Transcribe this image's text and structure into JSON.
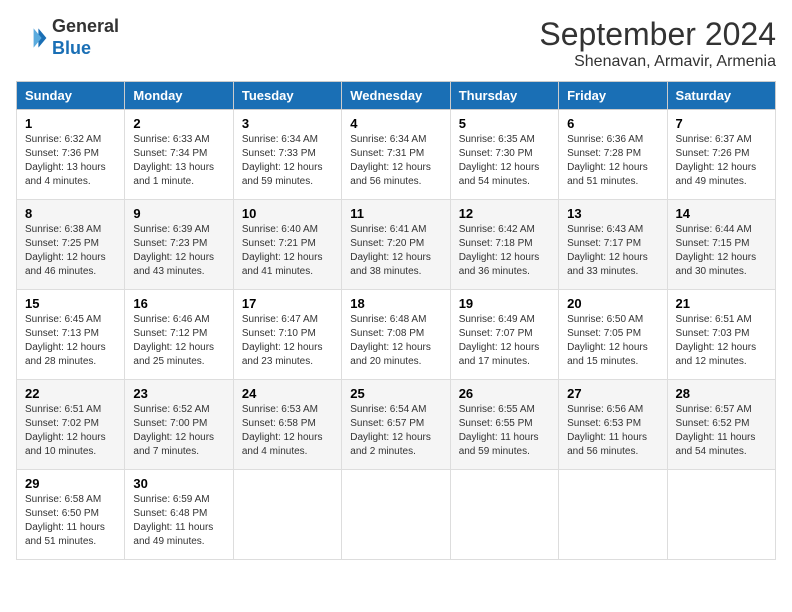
{
  "logo": {
    "line1": "General",
    "line2": "Blue"
  },
  "title": "September 2024",
  "subtitle": "Shenavan, Armavir, Armenia",
  "days_of_week": [
    "Sunday",
    "Monday",
    "Tuesday",
    "Wednesday",
    "Thursday",
    "Friday",
    "Saturday"
  ],
  "weeks": [
    [
      {
        "day": "1",
        "info": "Sunrise: 6:32 AM\nSunset: 7:36 PM\nDaylight: 13 hours and 4 minutes."
      },
      {
        "day": "2",
        "info": "Sunrise: 6:33 AM\nSunset: 7:34 PM\nDaylight: 13 hours and 1 minute."
      },
      {
        "day": "3",
        "info": "Sunrise: 6:34 AM\nSunset: 7:33 PM\nDaylight: 12 hours and 59 minutes."
      },
      {
        "day": "4",
        "info": "Sunrise: 6:34 AM\nSunset: 7:31 PM\nDaylight: 12 hours and 56 minutes."
      },
      {
        "day": "5",
        "info": "Sunrise: 6:35 AM\nSunset: 7:30 PM\nDaylight: 12 hours and 54 minutes."
      },
      {
        "day": "6",
        "info": "Sunrise: 6:36 AM\nSunset: 7:28 PM\nDaylight: 12 hours and 51 minutes."
      },
      {
        "day": "7",
        "info": "Sunrise: 6:37 AM\nSunset: 7:26 PM\nDaylight: 12 hours and 49 minutes."
      }
    ],
    [
      {
        "day": "8",
        "info": "Sunrise: 6:38 AM\nSunset: 7:25 PM\nDaylight: 12 hours and 46 minutes."
      },
      {
        "day": "9",
        "info": "Sunrise: 6:39 AM\nSunset: 7:23 PM\nDaylight: 12 hours and 43 minutes."
      },
      {
        "day": "10",
        "info": "Sunrise: 6:40 AM\nSunset: 7:21 PM\nDaylight: 12 hours and 41 minutes."
      },
      {
        "day": "11",
        "info": "Sunrise: 6:41 AM\nSunset: 7:20 PM\nDaylight: 12 hours and 38 minutes."
      },
      {
        "day": "12",
        "info": "Sunrise: 6:42 AM\nSunset: 7:18 PM\nDaylight: 12 hours and 36 minutes."
      },
      {
        "day": "13",
        "info": "Sunrise: 6:43 AM\nSunset: 7:17 PM\nDaylight: 12 hours and 33 minutes."
      },
      {
        "day": "14",
        "info": "Sunrise: 6:44 AM\nSunset: 7:15 PM\nDaylight: 12 hours and 30 minutes."
      }
    ],
    [
      {
        "day": "15",
        "info": "Sunrise: 6:45 AM\nSunset: 7:13 PM\nDaylight: 12 hours and 28 minutes."
      },
      {
        "day": "16",
        "info": "Sunrise: 6:46 AM\nSunset: 7:12 PM\nDaylight: 12 hours and 25 minutes."
      },
      {
        "day": "17",
        "info": "Sunrise: 6:47 AM\nSunset: 7:10 PM\nDaylight: 12 hours and 23 minutes."
      },
      {
        "day": "18",
        "info": "Sunrise: 6:48 AM\nSunset: 7:08 PM\nDaylight: 12 hours and 20 minutes."
      },
      {
        "day": "19",
        "info": "Sunrise: 6:49 AM\nSunset: 7:07 PM\nDaylight: 12 hours and 17 minutes."
      },
      {
        "day": "20",
        "info": "Sunrise: 6:50 AM\nSunset: 7:05 PM\nDaylight: 12 hours and 15 minutes."
      },
      {
        "day": "21",
        "info": "Sunrise: 6:51 AM\nSunset: 7:03 PM\nDaylight: 12 hours and 12 minutes."
      }
    ],
    [
      {
        "day": "22",
        "info": "Sunrise: 6:51 AM\nSunset: 7:02 PM\nDaylight: 12 hours and 10 minutes."
      },
      {
        "day": "23",
        "info": "Sunrise: 6:52 AM\nSunset: 7:00 PM\nDaylight: 12 hours and 7 minutes."
      },
      {
        "day": "24",
        "info": "Sunrise: 6:53 AM\nSunset: 6:58 PM\nDaylight: 12 hours and 4 minutes."
      },
      {
        "day": "25",
        "info": "Sunrise: 6:54 AM\nSunset: 6:57 PM\nDaylight: 12 hours and 2 minutes."
      },
      {
        "day": "26",
        "info": "Sunrise: 6:55 AM\nSunset: 6:55 PM\nDaylight: 11 hours and 59 minutes."
      },
      {
        "day": "27",
        "info": "Sunrise: 6:56 AM\nSunset: 6:53 PM\nDaylight: 11 hours and 56 minutes."
      },
      {
        "day": "28",
        "info": "Sunrise: 6:57 AM\nSunset: 6:52 PM\nDaylight: 11 hours and 54 minutes."
      }
    ],
    [
      {
        "day": "29",
        "info": "Sunrise: 6:58 AM\nSunset: 6:50 PM\nDaylight: 11 hours and 51 minutes."
      },
      {
        "day": "30",
        "info": "Sunrise: 6:59 AM\nSunset: 6:48 PM\nDaylight: 11 hours and 49 minutes."
      },
      {
        "day": "",
        "info": ""
      },
      {
        "day": "",
        "info": ""
      },
      {
        "day": "",
        "info": ""
      },
      {
        "day": "",
        "info": ""
      },
      {
        "day": "",
        "info": ""
      }
    ]
  ]
}
